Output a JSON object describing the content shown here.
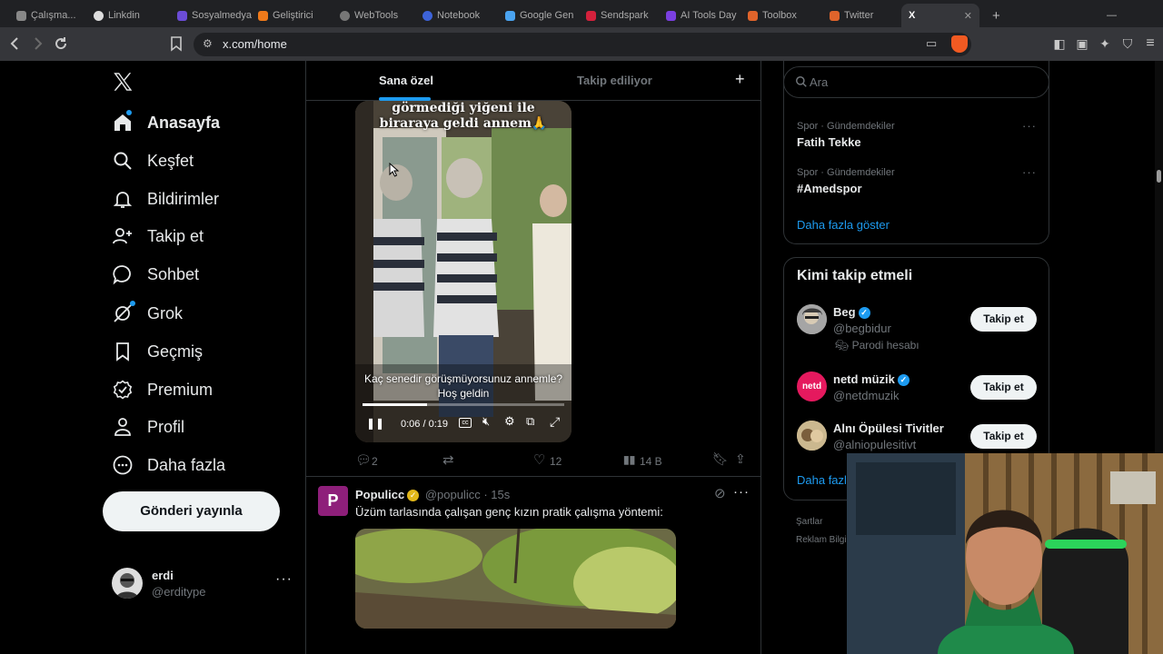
{
  "browser": {
    "url": "x.com/home",
    "tabs": [
      "Çalışma...",
      "Linkdin",
      "Sosyalmedya",
      "Geliştirici",
      "WebTools",
      "Notebook",
      "Google Gen",
      "Sendspark",
      "AI Tools Day",
      "Toolbox",
      "Twitter",
      "X"
    ]
  },
  "colors": {
    "accent": "#1d9bf0",
    "background": "#000000",
    "border": "#2f3336",
    "muted": "#71767b"
  },
  "sidebar": {
    "logo": "X",
    "items": [
      {
        "label": "Anasayfa",
        "icon": "home-icon"
      },
      {
        "label": "Keşfet",
        "icon": "search-icon"
      },
      {
        "label": "Bildirimler",
        "icon": "bell-icon"
      },
      {
        "label": "Takip et",
        "icon": "follow-icon"
      },
      {
        "label": "Sohbet",
        "icon": "chat-icon"
      },
      {
        "label": "Grok",
        "icon": "grok-icon"
      },
      {
        "label": "Geçmiş",
        "icon": "bookmark-icon"
      },
      {
        "label": "Premium",
        "icon": "premium-icon"
      },
      {
        "label": "Profil",
        "icon": "profile-icon"
      },
      {
        "label": "Daha fazla",
        "icon": "more-circle-icon"
      }
    ],
    "post_button": "Gönderi yayınla",
    "account": {
      "name": "erdi",
      "handle": "@erditype"
    }
  },
  "feed": {
    "tabs": [
      {
        "label": "Sana özel",
        "active": true
      },
      {
        "label": "Takip ediliyor",
        "active": false
      }
    ],
    "video_tweet": {
      "overlay_caption": "görmediği yiğeni ile biraraya geldi annem🙏",
      "subtitle": "Kaç senedir görüşmüyorsunuz annemle? Hoş geldin",
      "time": "0:06 / 0:19",
      "progress": 0.32,
      "replies": "2",
      "likes": "12",
      "views": "14 B"
    },
    "tweet2": {
      "name": "Populicc",
      "handle": "@populicc",
      "time": "15s",
      "text": "Üzüm tarlasında çalışan genç kızın pratik çalışma yöntemi:"
    }
  },
  "right": {
    "search_placeholder": "Ara",
    "trends": [
      {
        "category": "Spor · Gündemdekiler",
        "topic": "Fatih Tekke"
      },
      {
        "category": "Spor · Gündemdekiler",
        "topic": "#Amedspor"
      }
    ],
    "show_more": "Daha fazla göster",
    "who_to_follow_title": "Kimi takip etmeli",
    "suggestions": [
      {
        "name": "Beg",
        "handle": "@begbidur",
        "note": "Parodi hesabı",
        "button": "Takip et"
      },
      {
        "name": "netd müzik",
        "handle": "@netdmuzik",
        "button": "Takip et"
      },
      {
        "name": "Alnı Öpülesi Tivitler",
        "handle": "@alniopulesitivt",
        "button": "Takip et"
      }
    ],
    "show_more_2": "Daha fazla",
    "footer": [
      "Şartlar",
      "Reklam Bilgileri"
    ]
  }
}
